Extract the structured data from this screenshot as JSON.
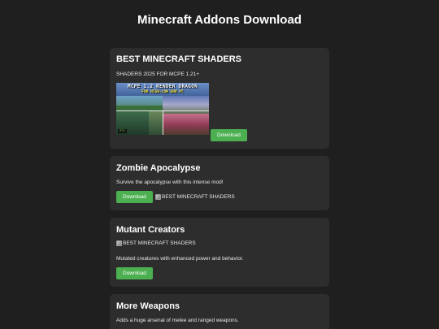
{
  "page": {
    "title": "Minecraft Addons Download"
  },
  "cards": [
    {
      "title": "BEST MINECRAFT SHADERS",
      "subtitle": "SHADERS 2025 FOR MCPE 1.21+",
      "thumbnail": {
        "line1": "MCPE 1.2 RENDER DRAGON",
        "line2": "FOR HIGH-LOW END PC",
        "badge": "RTX"
      },
      "button_label": "Download"
    },
    {
      "title": "Zombie Apocalypse",
      "description": "Survive the apocalypse with this intense mod!",
      "button_label": "Download",
      "broken_image_alt": "BEST MINECRAFT SHADERS"
    },
    {
      "title": "Mutant Creators",
      "broken_image_alt": "BEST MINECRAFT SHADERS",
      "description": "Mutated creatures with enhanced power and behavior.",
      "button_label": "Download"
    },
    {
      "title": "More Weapons",
      "description": "Adds a huge arsenal of melee and ranged weapons."
    }
  ],
  "colors": {
    "background": "#1f1f1f",
    "card": "#2d2d2d",
    "button": "#4caf50"
  }
}
